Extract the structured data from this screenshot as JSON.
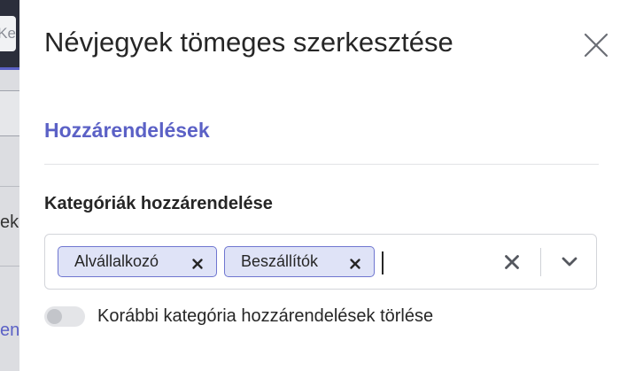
{
  "background": {
    "search_fragment": "Ke",
    "text_fragment_1": "ek",
    "text_fragment_2": "en"
  },
  "modal": {
    "title": "Névjegyek tömeges szerkesztése",
    "close_icon": "close-icon",
    "section_heading": "Hozzárendelések",
    "category_field": {
      "label": "Kategóriák hozzárendelése",
      "selected_tags": [
        {
          "label": "Alvállalkozó"
        },
        {
          "label": "Beszállítók"
        }
      ],
      "input_value": ""
    },
    "toggle": {
      "label": "Korábbi kategória hozzárendelések törlése",
      "checked": false
    }
  },
  "colors": {
    "accent": "#5b61c6",
    "tag_background": "#dfe3f7",
    "tag_border": "#6f76d0",
    "text": "#262626"
  }
}
